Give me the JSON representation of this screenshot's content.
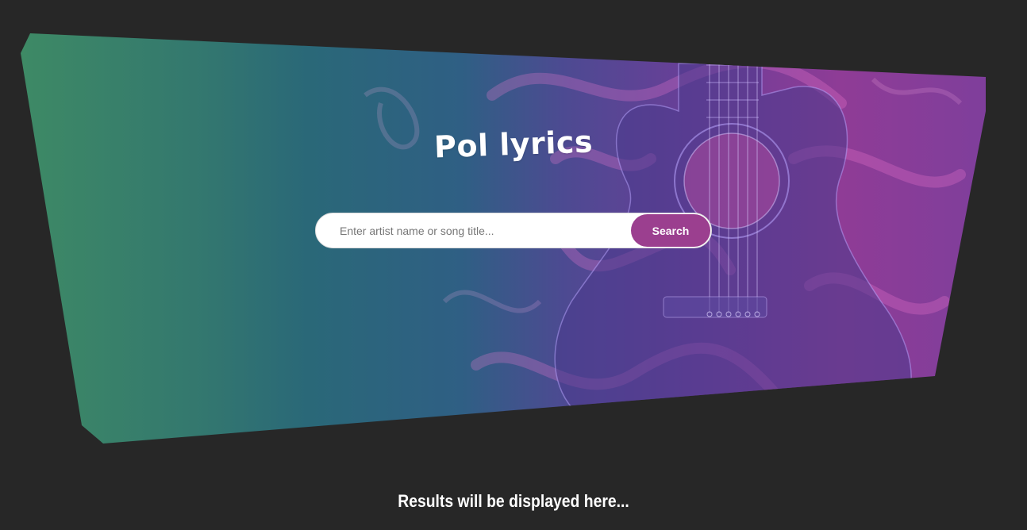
{
  "app": {
    "title": "Pol lyrics"
  },
  "search": {
    "placeholder": "Enter artist name or song title...",
    "value": "",
    "button_label": "Search"
  },
  "results": {
    "message": "Results will be displayed here..."
  },
  "colors": {
    "page_background": "#272727",
    "accent": "#9b3f8f",
    "gradient_start": "#3f8c64",
    "gradient_end": "#8f3c96",
    "text": "#ffffff"
  },
  "icons": {
    "hero_art": "guitar-smoke-icon"
  }
}
